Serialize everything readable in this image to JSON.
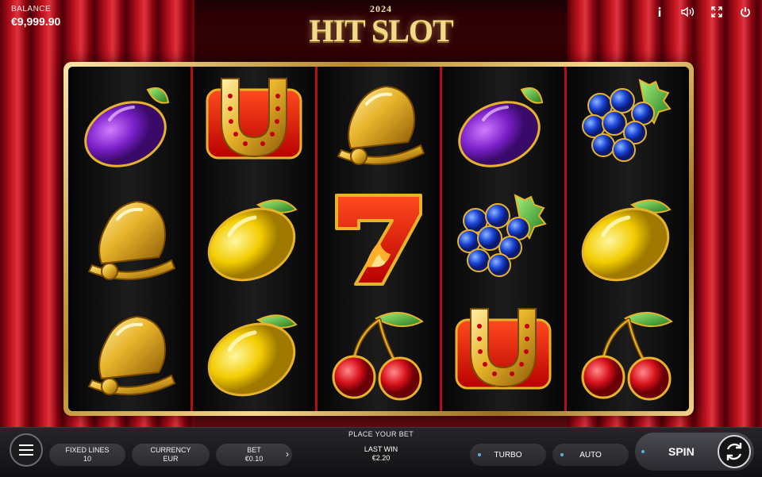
{
  "header": {
    "balance_label": "BALANCE",
    "balance_value": "€9,999.90",
    "logo_year": "2024",
    "logo_name": "HIT SLOT",
    "icons": [
      "info-icon",
      "sound-icon",
      "fullscreen-icon",
      "power-icon"
    ]
  },
  "reels": [
    [
      "plum",
      "bell",
      "bell"
    ],
    [
      "horseshoe",
      "lemon",
      "lemon"
    ],
    [
      "bell",
      "seven",
      "cherries"
    ],
    [
      "plum",
      "grapes",
      "horseshoe"
    ],
    [
      "grapes",
      "lemon",
      "cherries"
    ]
  ],
  "controls": {
    "place_bet": "PLACE YOUR BET",
    "fixed_lines_label": "FIXED LINES",
    "fixed_lines_value": "10",
    "currency_label": "CURRENCY",
    "currency_value": "EUR",
    "bet_label": "BET",
    "bet_value": "€0.10",
    "bet_arrow": "›",
    "last_win_label": "LAST WIN",
    "last_win_value": "€2.20",
    "turbo_label": "TURBO",
    "auto_label": "AUTO",
    "spin_label": "SPIN"
  },
  "colors": {
    "curtain": "#c1121f",
    "frame_gold": "#d9b25a",
    "reel_divider": "#b40d18"
  }
}
